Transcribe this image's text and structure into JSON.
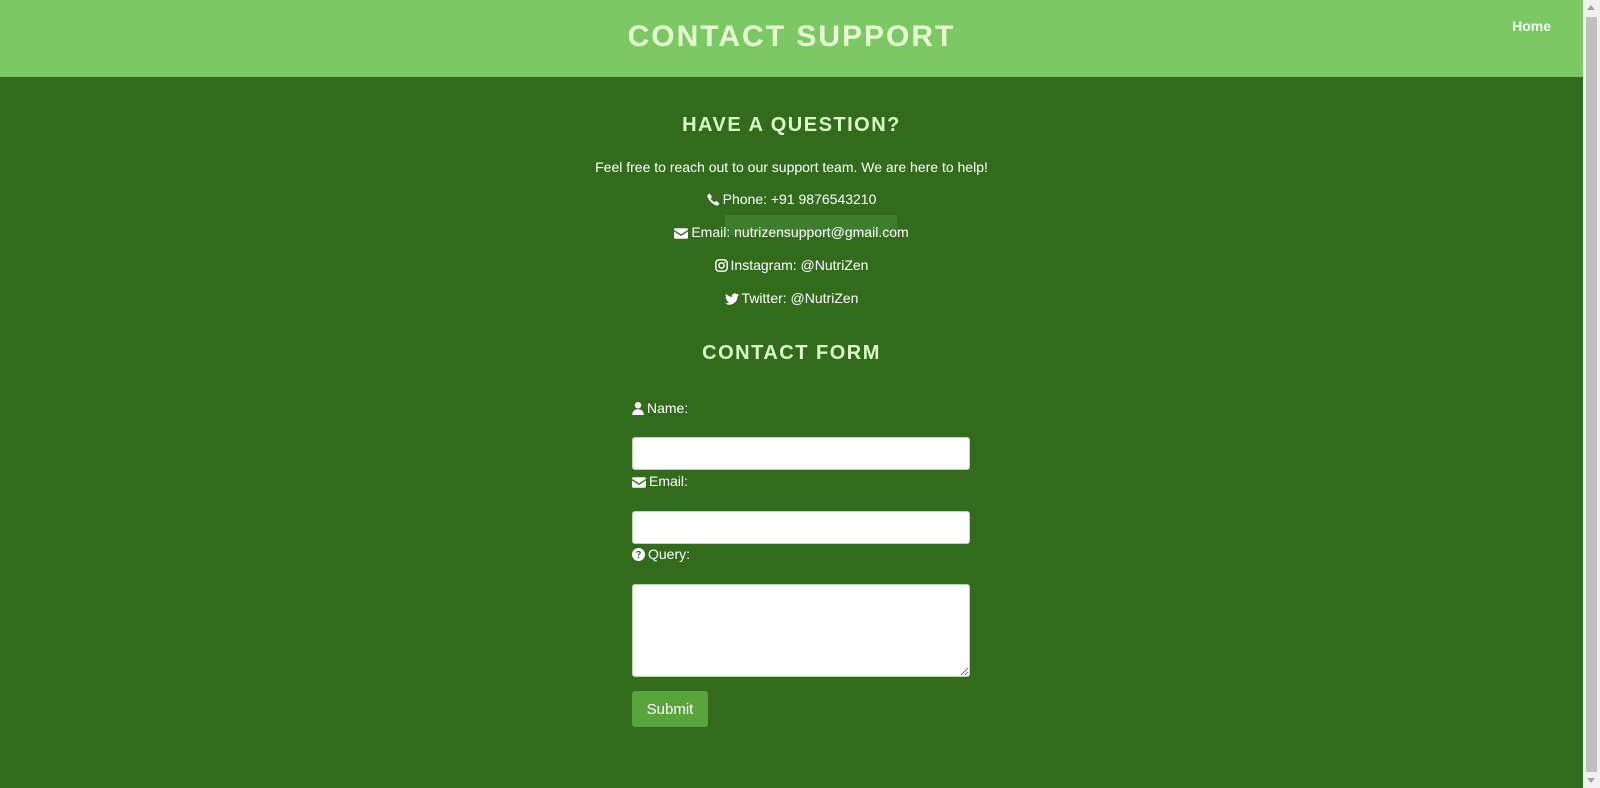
{
  "header": {
    "title": "CONTACT SUPPORT",
    "nav_home": "Home"
  },
  "info": {
    "heading": "HAVE A QUESTION?",
    "intro": "Feel free to reach out to our support team. We are here to help!",
    "phone": "Phone: +91 9876543210",
    "email": "Email: nutrizensupport@gmail.com",
    "instagram": "Instagram: @NutriZen",
    "twitter": "Twitter: @NutriZen"
  },
  "form": {
    "heading": "CONTACT FORM",
    "name_label": "Name:",
    "name_value": "",
    "email_label": "Email:",
    "email_value": "",
    "query_label": "Query:",
    "query_value": "",
    "submit_label": "Submit"
  },
  "icons": {
    "phone": "phone-icon",
    "email": "envelope-icon",
    "instagram": "instagram-icon",
    "twitter": "twitter-icon",
    "user": "user-icon",
    "question": "question-circle-icon"
  },
  "colors": {
    "header_bg": "#7bc864",
    "page_bg": "#316b1b",
    "heading_text": "#dcfbc8",
    "button_bg": "#5aa43d"
  }
}
